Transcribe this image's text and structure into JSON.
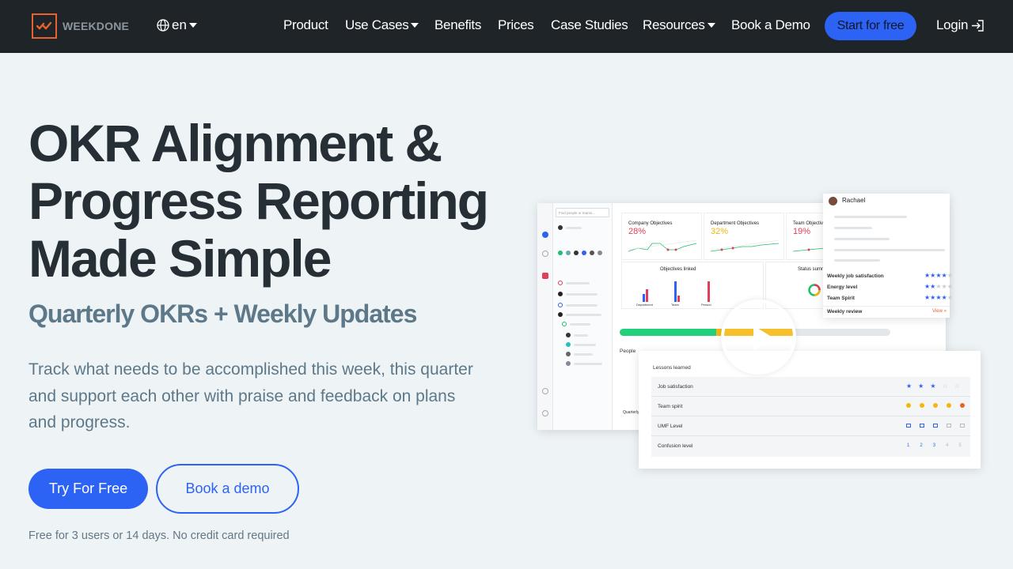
{
  "brand": {
    "name": "WEEKDONE",
    "accent": "#e8622c"
  },
  "nav": {
    "language": "en",
    "items": [
      "Product",
      "Use Cases",
      "Benefits",
      "Prices",
      "Case Studies",
      "Resources",
      "Book a Demo"
    ],
    "start_label": "Start for free",
    "login_label": "Login"
  },
  "hero": {
    "title": "OKR Alignment & Progress Reporting Made Simple",
    "subtitle": "Quarterly OKRs + Weekly Updates",
    "description": "Track what needs to be accomplished this week, this quarter and support each other with praise and feedback on plans and progress.",
    "primary_cta": "Try For Free",
    "secondary_cta": "Book a demo",
    "note": "Free for 3 users or 14 days. No credit card required"
  },
  "mockup": {
    "search_placeholder": "Find people or teams...",
    "stats": [
      {
        "label": "Company Objectives",
        "value": "28%",
        "color": "#e23d5a"
      },
      {
        "label": "Department Objectives",
        "value": "32%",
        "color": "#f0b60f"
      },
      {
        "label": "Team Objectives",
        "value": "19%",
        "color": "#e23d5a"
      }
    ],
    "objectives_linked": "Objectives linked",
    "status_summary": "Status summary",
    "bar_labels": [
      "Department",
      "Team",
      "Person"
    ],
    "people": "People",
    "quarterly": "Quarterly",
    "user": "Rachael",
    "ratings": [
      {
        "label": "Weekly job satisfaction",
        "stars": 4
      },
      {
        "label": "Energy level",
        "stars": 2
      },
      {
        "label": "Team Spirit",
        "stars": 4
      }
    ],
    "weekly_review": "Weekly review",
    "view": "View »",
    "lessons": "Lessons learned",
    "lesson_rows": [
      {
        "label": "Job satisfaction"
      },
      {
        "label": "Team spirit"
      },
      {
        "label": "UMF Level"
      },
      {
        "label": "Confusion level",
        "scale": [
          "1",
          "2",
          "3",
          "4",
          "5"
        ]
      }
    ],
    "progress_fraction": 0.65
  }
}
